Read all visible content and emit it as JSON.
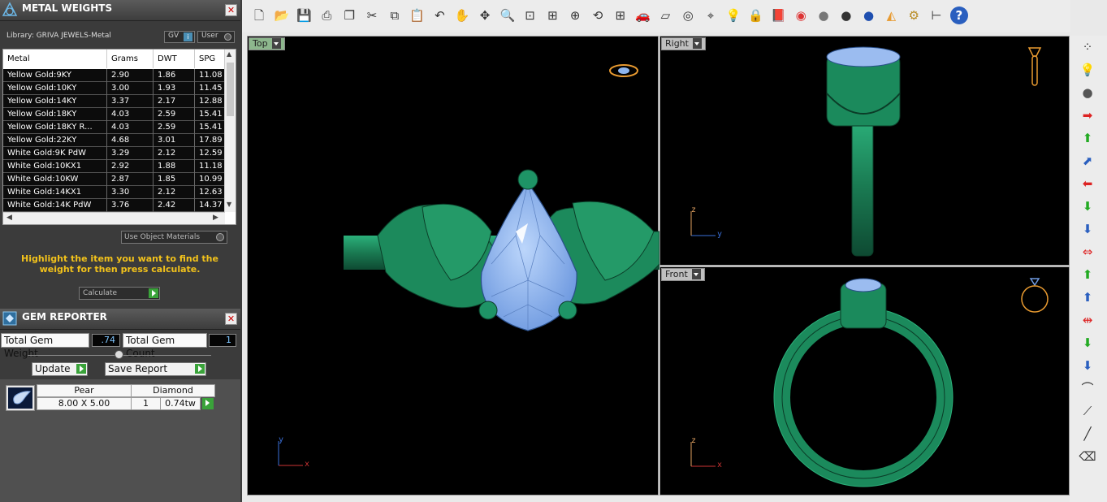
{
  "metal_weights": {
    "title": "METAL WEIGHTS",
    "close": "✕",
    "library": "Library: GRIVA JEWELS-Metal",
    "gv_label": "GV",
    "gv_check": "i",
    "user_label": "User",
    "columns": [
      "Metal",
      "Grams",
      "DWT",
      "SPG"
    ],
    "rows": [
      [
        "Yellow Gold:9KY",
        "2.90",
        "1.86",
        "11.08"
      ],
      [
        "Yellow Gold:10KY",
        "3.00",
        "1.93",
        "11.45"
      ],
      [
        "Yellow Gold:14KY",
        "3.37",
        "2.17",
        "12.88"
      ],
      [
        "Yellow Gold:18KY",
        "4.03",
        "2.59",
        "15.41"
      ],
      [
        "Yellow Gold:18KY R...",
        "4.03",
        "2.59",
        "15.41"
      ],
      [
        "Yellow Gold:22KY",
        "4.68",
        "3.01",
        "17.89"
      ],
      [
        "White Gold:9K PdW",
        "3.29",
        "2.12",
        "12.59"
      ],
      [
        "White Gold:10KX1",
        "2.92",
        "1.88",
        "11.18"
      ],
      [
        "White Gold:10KW",
        "2.87",
        "1.85",
        "10.99"
      ],
      [
        "White Gold:14KX1",
        "3.30",
        "2.12",
        "12.63"
      ],
      [
        "White Gold:14K PdW",
        "3.76",
        "2.42",
        "14.37"
      ]
    ],
    "use_object_materials": "Use Object Materials",
    "hint": "Highlight the item you want to find the weight for then press calculate.",
    "calculate": "Calculate"
  },
  "gem_reporter": {
    "title": "GEM REPORTER",
    "close": "✕",
    "total_weight_label": "Total Gem Weight",
    "total_weight_value": ".74",
    "total_count_label": "Total Gem Count",
    "total_count_value": "1",
    "update_label": "Update",
    "save_report_label": "Save Report",
    "gem": {
      "shape": "Pear",
      "type": "Diamond",
      "size": "8.00 X 5.00",
      "count": "1",
      "weight": "0.74tw"
    }
  },
  "viewports": {
    "top": "Top",
    "right": "Right",
    "front": "Front"
  },
  "axes": {
    "top": [
      "y",
      "x"
    ],
    "right": [
      "z",
      "y"
    ],
    "front": [
      "z",
      "x"
    ]
  },
  "colors": {
    "metal": "#1f8a5e",
    "gem": "#8fb6ee",
    "viewport_bg": "#000000",
    "hint": "#f2c21b",
    "panel": "#3b3b3b"
  },
  "toolbar_icons": [
    "new-file-icon",
    "open-folder-icon",
    "save-icon",
    "print-icon",
    "copy-doc-icon",
    "cut-icon",
    "copy-icon",
    "paste-icon",
    "undo-icon",
    "pan-hand-icon",
    "move-icon",
    "zoom-icon",
    "zoom-window-icon",
    "zoom-extents-icon",
    "zoom-selected-icon",
    "rotate-view-icon",
    "four-views-icon",
    "car-icon",
    "flat-icon",
    "circle-icon",
    "snap-icon",
    "light-bulb-icon",
    "lock-icon",
    "book-icon",
    "color-wheel-icon",
    "sphere-gray-icon",
    "sphere-dark-icon",
    "sphere-blue-icon",
    "cone-icon",
    "gear-icon",
    "hierarchy-icon",
    "help-icon"
  ],
  "right_icons": [
    "render-dots-icon",
    "bulb-icon",
    "sphere-icon",
    "arrow-right-icon",
    "arrow-up-icon",
    "arrow-diag-icon",
    "arrow-left-icon",
    "arrow-down-icon",
    "arrow-down-blue-icon",
    "arrow-expand-h-icon",
    "arrow-up-green-icon",
    "arrow-up-blue-icon",
    "arrow-collapse-h-icon",
    "arrow-down-green-icon",
    "arrow-down-blue2-icon",
    "curve-icon",
    "line-point-icon",
    "line-icon",
    "eraser-icon"
  ]
}
